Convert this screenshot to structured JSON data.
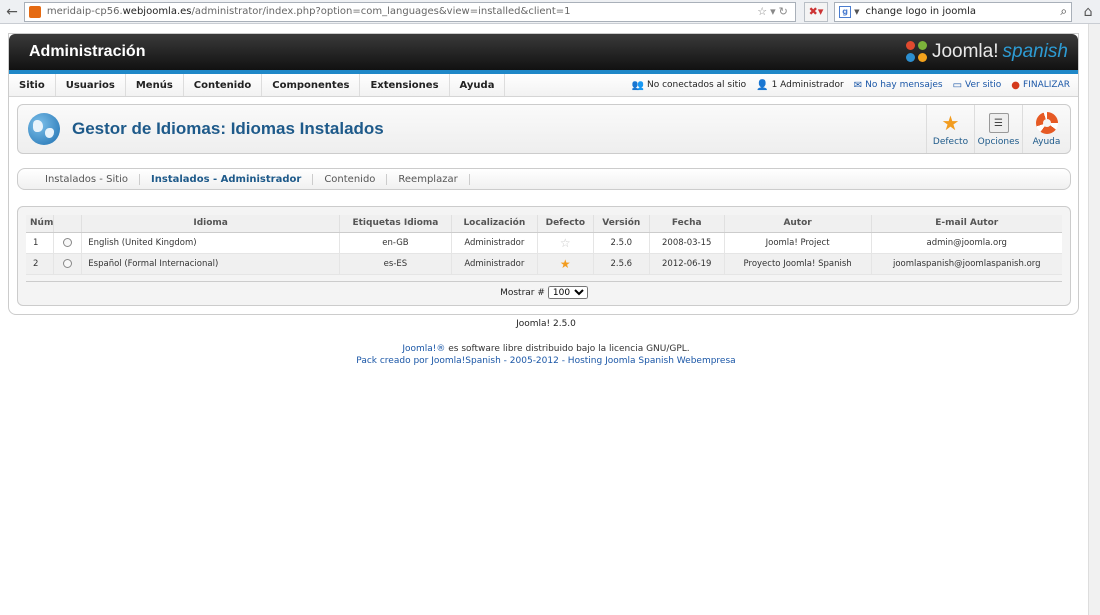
{
  "browser": {
    "url_prefix": "meridaip-cp56.",
    "url_host": "webjoomla.es",
    "url_path": "/administrator/index.php?option=com_languages&view=installed&client=1",
    "search_query": "change logo in joomla"
  },
  "header": {
    "title": "Administración",
    "brand_word": "Joomla!",
    "brand_suffix": "spanish"
  },
  "menu": {
    "items": [
      "Sitio",
      "Usuarios",
      "Menús",
      "Contenido",
      "Componentes",
      "Extensiones",
      "Ayuda"
    ]
  },
  "status": {
    "visitors": "No conectados al sitio",
    "admins": "1 Administrador",
    "messages": "No hay mensajes",
    "view_site": "Ver sitio",
    "logout": "FINALIZAR"
  },
  "page": {
    "title": "Gestor de Idiomas: Idiomas Instalados"
  },
  "toolbar": {
    "default_label": "Defecto",
    "options_label": "Opciones",
    "help_label": "Ayuda"
  },
  "subnav": {
    "items": [
      "Instalados - Sitio",
      "Instalados - Administrador",
      "Contenido",
      "Reemplazar"
    ],
    "active_index": 1
  },
  "table": {
    "headers": [
      "Núm",
      "",
      "Idioma",
      "Etiquetas Idioma",
      "Localización",
      "Defecto",
      "Versión",
      "Fecha",
      "Autor",
      "E-mail Autor"
    ],
    "rows": [
      {
        "num": "1",
        "language": "English (United Kingdom)",
        "tag": "en-GB",
        "location": "Administrador",
        "default": false,
        "version": "2.5.0",
        "date": "2008-03-15",
        "author": "Joomla! Project",
        "email": "admin@joomla.org"
      },
      {
        "num": "2",
        "language": "Español (Formal Internacional)",
        "tag": "es-ES",
        "location": "Administrador",
        "default": true,
        "version": "2.5.6",
        "date": "2012-06-19",
        "author": "Proyecto Joomla! Spanish",
        "email": "joomlaspanish@joomlaspanish.org"
      }
    ]
  },
  "pager": {
    "label": "Mostrar #",
    "value": "100"
  },
  "footer": {
    "version": "Joomla! 2.5.0",
    "license_link": "Joomla!®",
    "license_text": " es software libre distribuido bajo la licencia GNU/GPL.",
    "pack_text": "Pack creado por Joomla!Spanish - 2005-2012 - Hosting Joomla Spanish Webempresa"
  }
}
